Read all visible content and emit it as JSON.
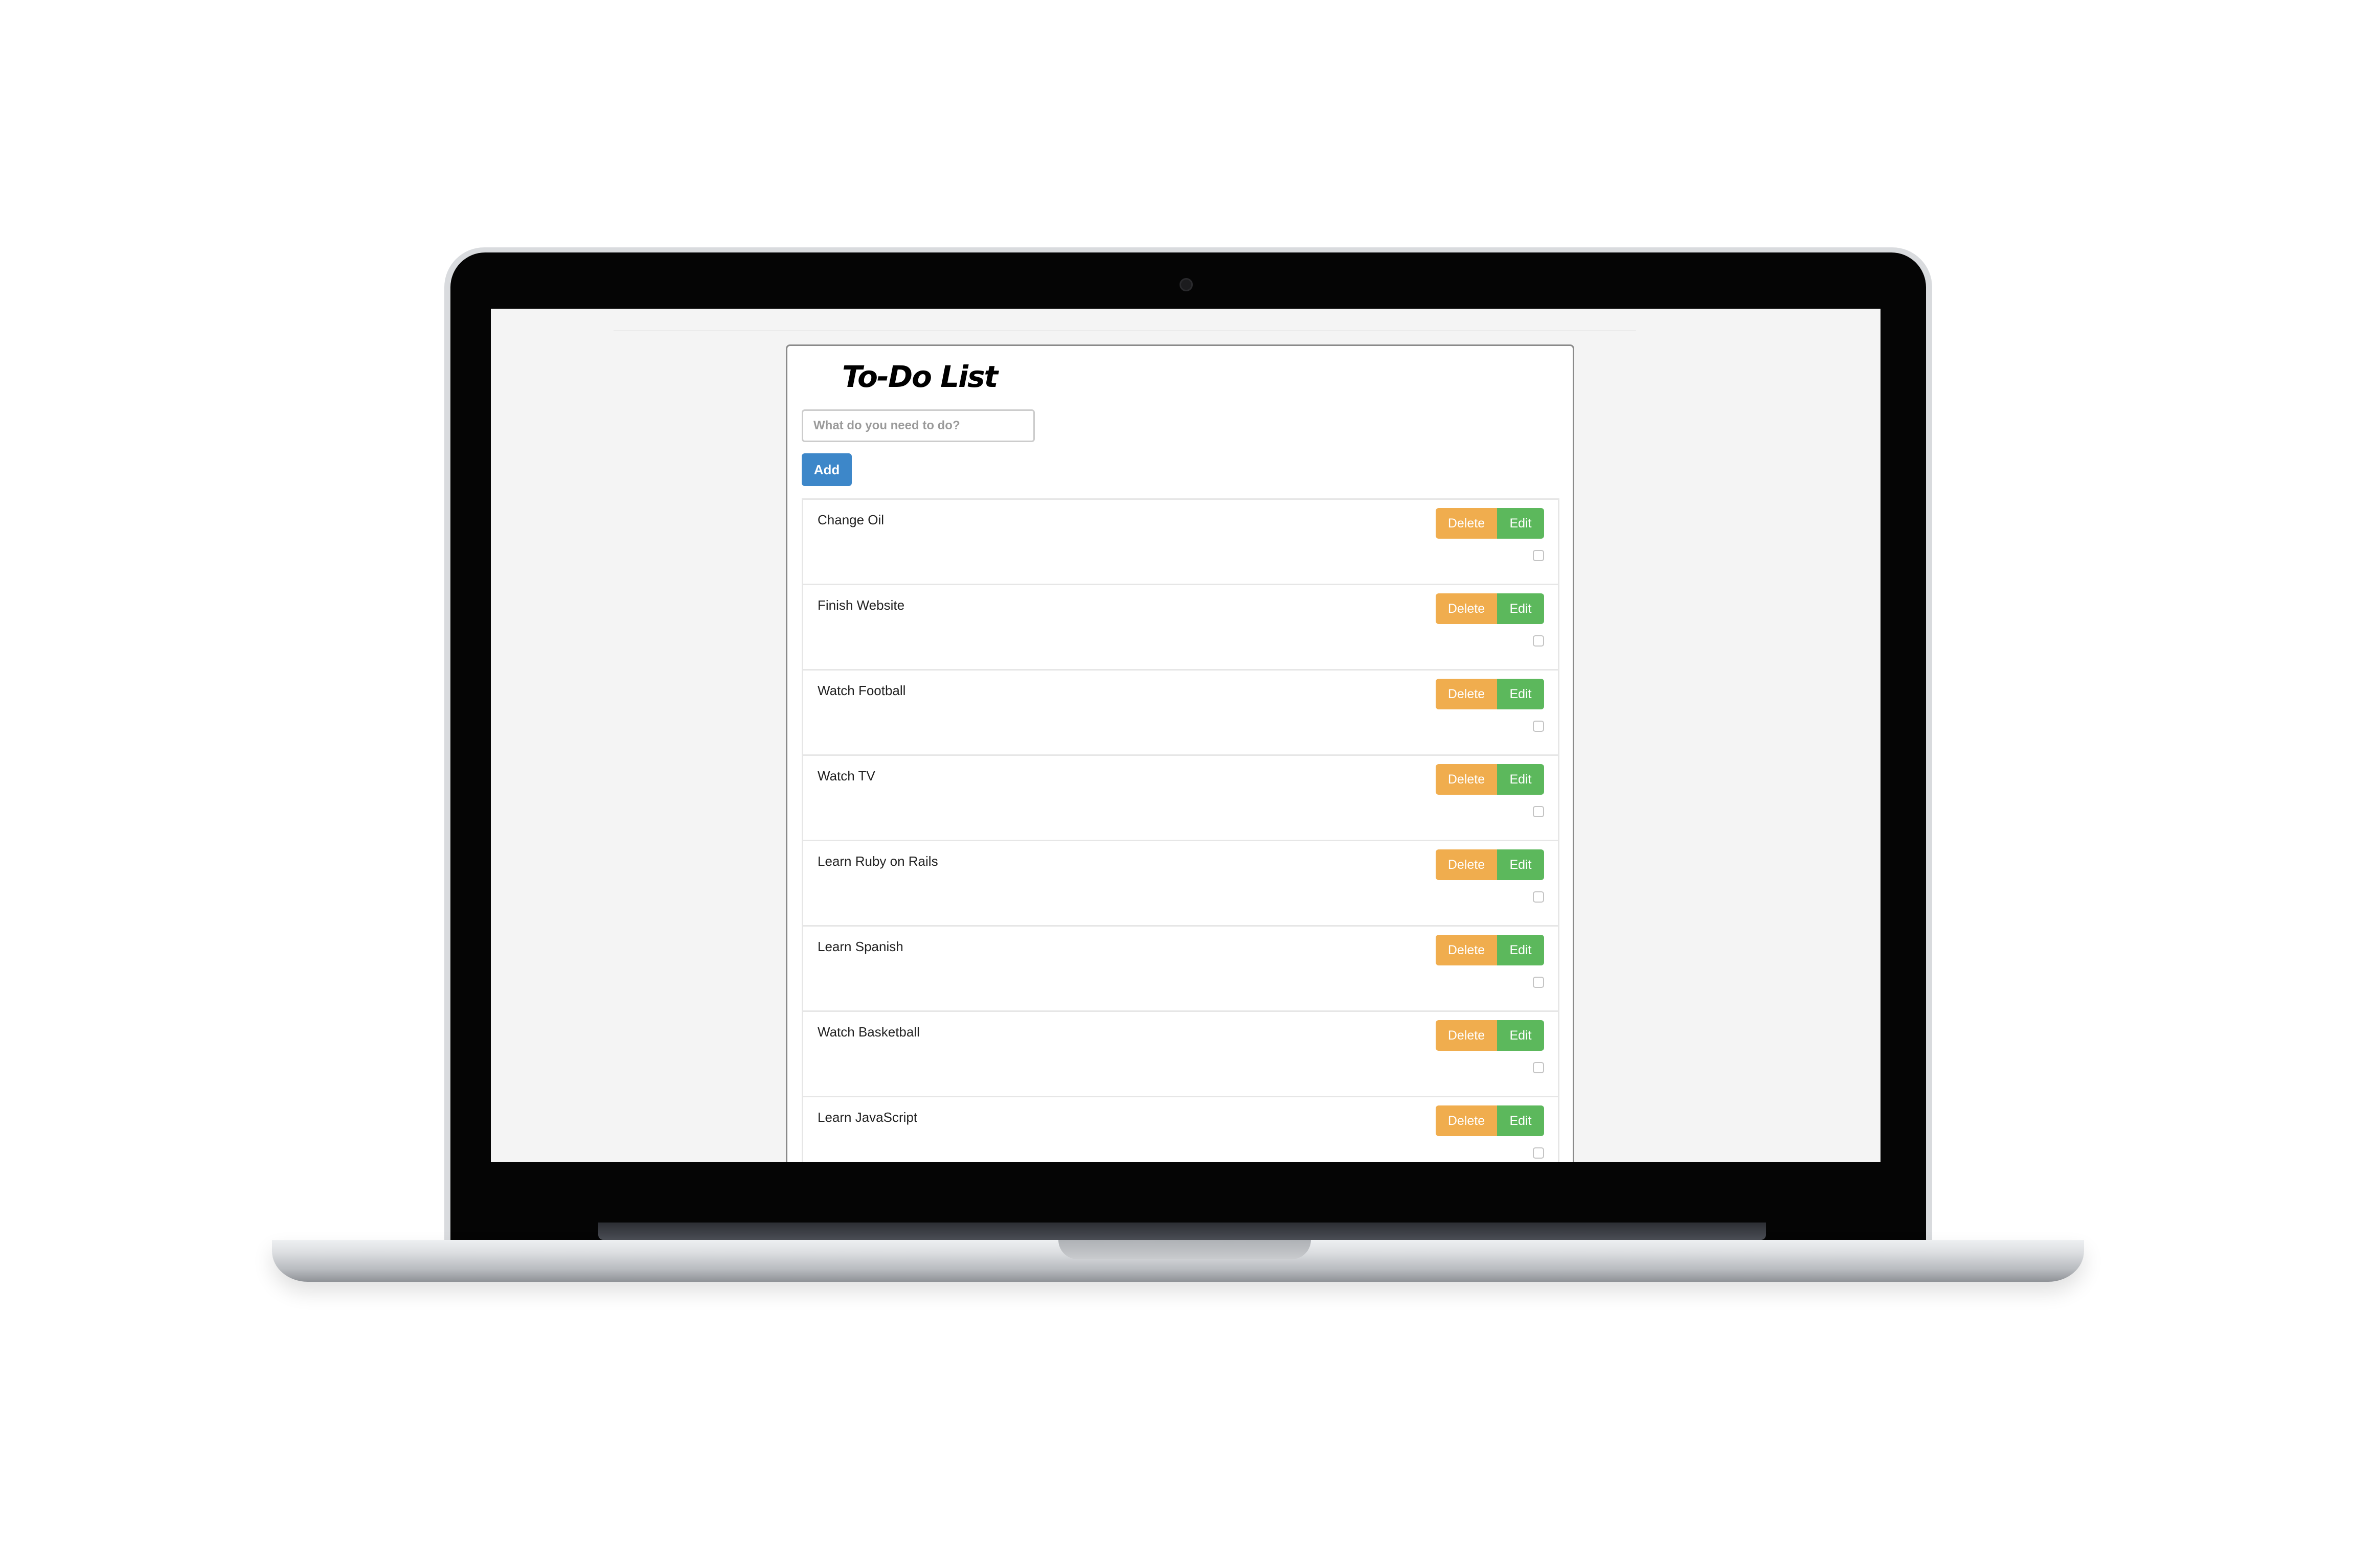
{
  "app": {
    "title": "To-Do List"
  },
  "new_task": {
    "placeholder": "What do you need to do?",
    "value": ""
  },
  "add_button": {
    "label": "Add"
  },
  "item_actions": {
    "delete_label": "Delete",
    "edit_label": "Edit"
  },
  "todos": [
    {
      "text": "Change Oil",
      "done": false
    },
    {
      "text": "Finish Website",
      "done": false
    },
    {
      "text": "Watch Football",
      "done": false
    },
    {
      "text": "Watch TV",
      "done": false
    },
    {
      "text": "Learn Ruby on Rails",
      "done": false
    },
    {
      "text": "Learn Spanish",
      "done": false
    },
    {
      "text": "Watch Basketball",
      "done": false
    },
    {
      "text": "Learn JavaScript",
      "done": false
    }
  ],
  "colors": {
    "add": "#3d87c9",
    "delete": "#f0ad4e",
    "edit": "#5cb85c",
    "page_background": "#f4f4f4"
  }
}
